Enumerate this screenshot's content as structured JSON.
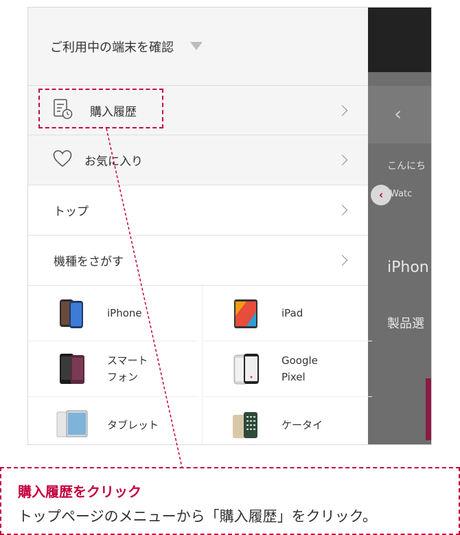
{
  "menu": {
    "header_label": "ご利用中の端末を確認",
    "items": [
      {
        "label": "購入履歴",
        "icon": "receipt-clock-icon"
      },
      {
        "label": "お気に入り",
        "icon": "heart-icon"
      },
      {
        "label": "トップ"
      },
      {
        "label": "機種をさがす"
      }
    ],
    "devices": [
      {
        "label": "iPhone",
        "icon": "iphone-icon"
      },
      {
        "label": "iPad",
        "icon": "ipad-icon"
      },
      {
        "label": "スマート\nフォン",
        "icon": "smartphone-icon"
      },
      {
        "label": "Google\nPixel",
        "icon": "google-pixel-icon"
      },
      {
        "label": "タブレット",
        "icon": "tablet-icon"
      },
      {
        "label": "ケータイ",
        "icon": "feature-phone-icon"
      }
    ]
  },
  "background": {
    "greeting": "こんにち",
    "watch": "ple Watc",
    "heading": "iPhon",
    "section": "製品選"
  },
  "callout": {
    "title": "購入履歴をクリック",
    "body": "トップページのメニューから「購入履歴」をクリック。"
  },
  "colors": {
    "accent": "#c5003e"
  }
}
